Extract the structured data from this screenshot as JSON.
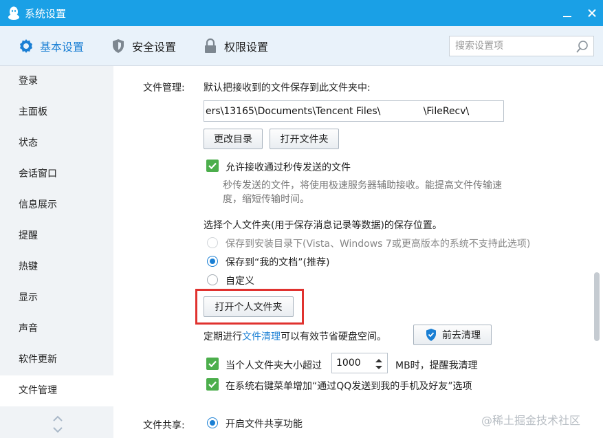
{
  "window": {
    "title": "系统设置"
  },
  "tabs": [
    {
      "label": "基本设置",
      "icon": "gear-icon",
      "active": true
    },
    {
      "label": "安全设置",
      "icon": "shield-icon",
      "active": false
    },
    {
      "label": "权限设置",
      "icon": "lock-icon",
      "active": false
    }
  ],
  "search": {
    "placeholder": "搜索设置项"
  },
  "sidebar": {
    "items": [
      "登录",
      "主面板",
      "状态",
      "会话窗口",
      "信息展示",
      "提醒",
      "热键",
      "显示",
      "声音",
      "软件更新",
      "文件管理"
    ],
    "active": "文件管理"
  },
  "file_mgmt": {
    "section_label": "文件管理:",
    "save_desc": "默认把接收到的文件保存到此文件夹中:",
    "path_value": "ers\\13165\\Documents\\Tencent Files\\              \\FileRecv\\",
    "change_dir_button": "更改目录",
    "open_folder_button": "打开文件夹",
    "flash_checkbox_label": "允许接收通过秒传发送的文件",
    "flash_desc_line1": "秒传发送的文件，将使用极速服务器辅助接收。能提高文件传输速",
    "flash_desc_line2": "度，缩短传输时间。",
    "personal_folder_desc": "选择个人文件夹(用于保存消息记录等数据)的保存位置。",
    "radio_install_dir": "保存到安装目录下(Vista、Windows 7或更高版本的系统不支持此选项)",
    "radio_my_documents": "保存到“我的文档”(推荐)",
    "radio_custom": "自定义",
    "open_personal_folder_button": "打开个人文件夹",
    "cleanup_prefix": "定期进行",
    "cleanup_link": "文件清理",
    "cleanup_suffix": "可以有效节省硬盘空间。",
    "go_clean_button": "前去清理",
    "size_alert_prefix": "当个人文件夹大小超过",
    "size_alert_value": "1000",
    "size_alert_suffix": "MB时，提醒我清理",
    "context_menu_label": "在系统右键菜单增加“通过QQ发送到我的手机及好友”选项"
  },
  "file_share": {
    "section_label": "文件共享:",
    "enable_label": "开启文件共享功能"
  },
  "watermark": "@稀土掘金技术社区",
  "colors": {
    "titlebar": "#1aa0e6",
    "accent": "#1a7fd4",
    "checkbox": "#4cae4c",
    "highlight": "#e0322f"
  }
}
